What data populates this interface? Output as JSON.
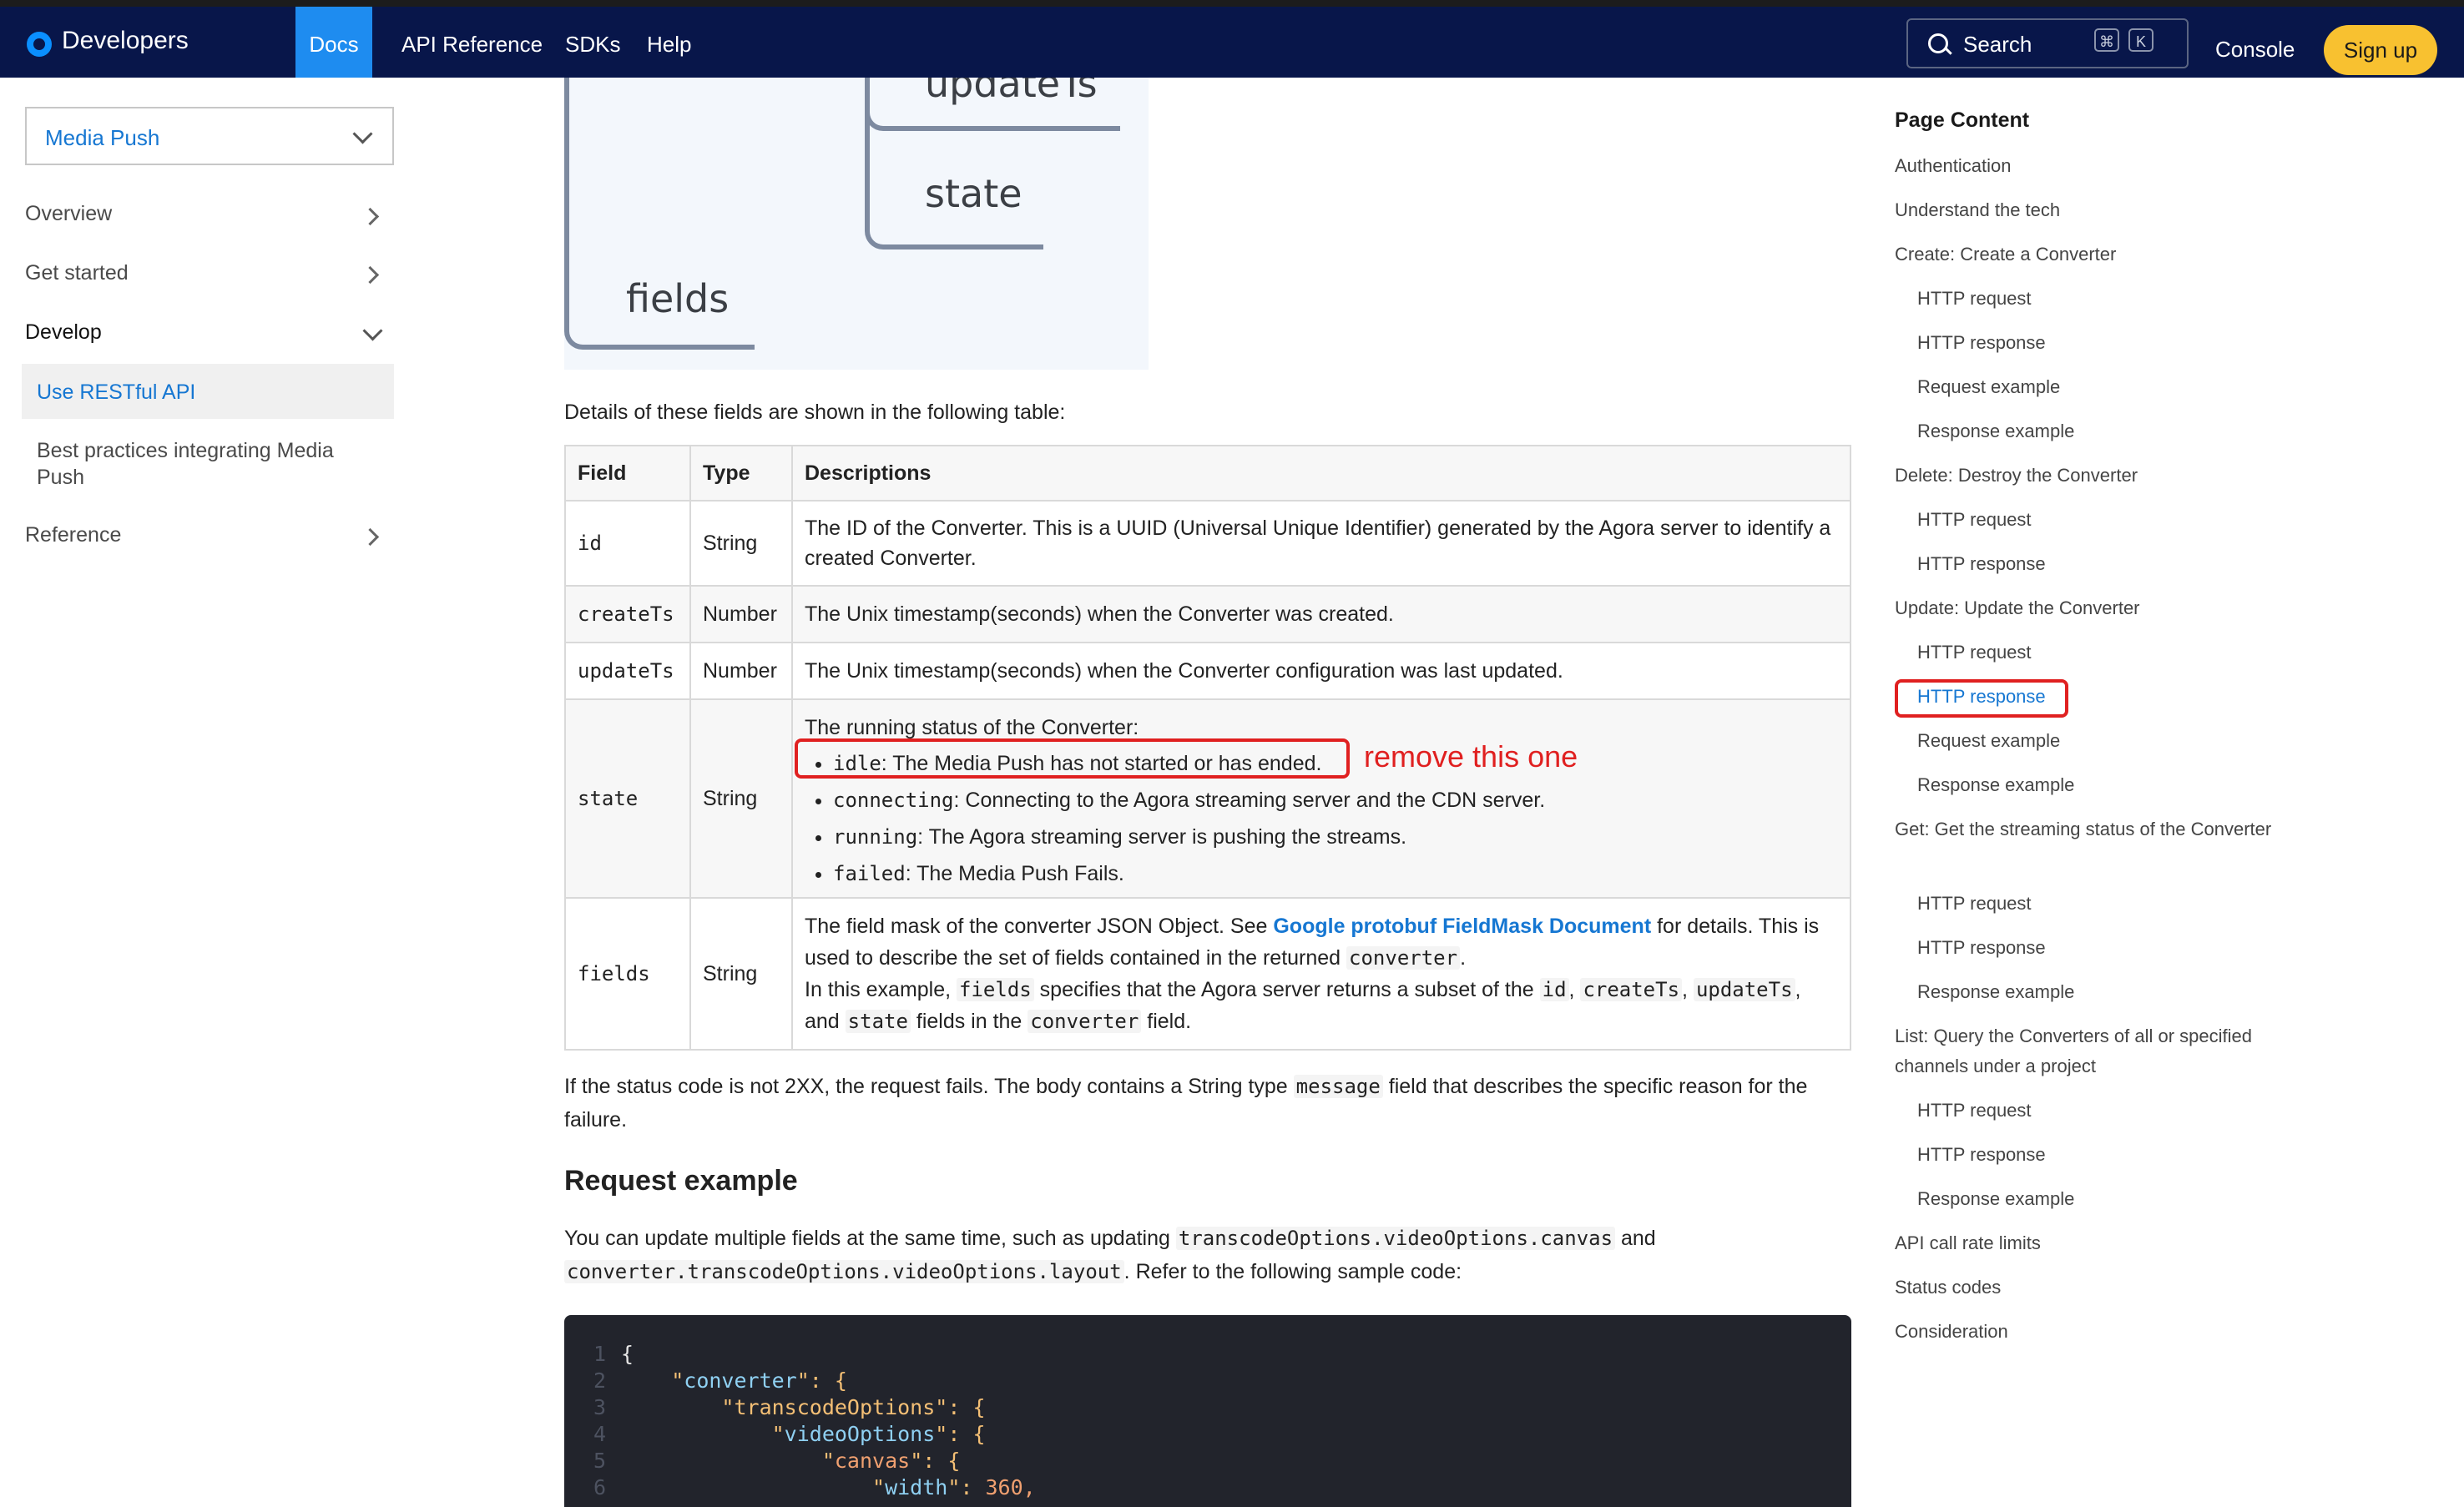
{
  "nav": {
    "brand": "Developers",
    "links": [
      "Docs",
      "API Reference",
      "SDKs",
      "Help"
    ],
    "search_label": "Search",
    "kbd_cmd": "⌘",
    "kbd_k": "K",
    "console": "Console",
    "signup": "Sign up",
    "colors": {
      "bar": "#08164a",
      "active": "#1e8cf0",
      "signup": "#f8c130"
    }
  },
  "sidebar": {
    "product": "Media Push",
    "items": [
      "Overview",
      "Get started",
      "Develop"
    ],
    "active_item": "Use RESTful API",
    "sub_item": "Best practices integrating Media Push",
    "reference": "Reference"
  },
  "diagram": {
    "labels": [
      "updateTs",
      "state",
      "fields"
    ]
  },
  "content": {
    "intro": "Details of these fields are shown in the following table:",
    "table": {
      "headers": [
        "Field",
        "Type",
        "Descriptions"
      ],
      "rows": [
        {
          "field": "id",
          "type": "String",
          "desc": "The ID of the Converter. This is a UUID (Universal Unique Identifier) generated by the Agora server to identify a created Converter."
        },
        {
          "field": "createTs",
          "type": "Number",
          "desc": "The Unix timestamp(seconds) when the Converter was created."
        },
        {
          "field": "updateTs",
          "type": "Number",
          "desc": "The Unix timestamp(seconds) when the Converter configuration was last updated."
        },
        {
          "field": "state",
          "type": "String",
          "desc_intro": "The running status of the Converter:",
          "states": [
            {
              "code": "idle",
              "text": ": The Media Push has not started or has ended."
            },
            {
              "code": "connecting",
              "text": ": Connecting to the Agora streaming server and the CDN server."
            },
            {
              "code": "running",
              "text": ": The Agora streaming server is pushing the streams."
            },
            {
              "code": "failed",
              "text": ": The Media Push Fails."
            }
          ]
        },
        {
          "field": "fields",
          "type": "String",
          "d1": "The field mask of the converter JSON Object. See ",
          "d1_link": "Google protobuf FieldMask Document",
          "d1_end": " for details. This is used to describe the set of fields contained in the returned ",
          "d1_code": "converter",
          "d1_dot": ".",
          "d2": "In this example, ",
          "d2_code1": "fields",
          "d2_mid": " specifies that the Agora server returns a subset of the ",
          "d2_code2": "id",
          "d2_comma1": ", ",
          "d2_code3": "createTs",
          "d2_comma2": ", ",
          "d2_code4": "updateTs",
          "d2_comma3": ",",
          "d2_and": " and ",
          "d2_code5": "state",
          "d2_in": " fields in the ",
          "d2_code6": "converter",
          "d2_end": " field."
        }
      ]
    },
    "failure_a": "If the status code is not 2XX, the request fails. The body contains a String type ",
    "failure_code": "message",
    "failure_b": " field that describes the specific reason for the failure.",
    "heading": "Request example",
    "req_a": "You can update multiple fields at the same time, such as updating ",
    "req_code1": "transcodeOptions.videoOptions.canvas",
    "req_and": " and ",
    "req_code2": "converter.transcodeOptions.videoOptions.layout",
    "req_b": ". Refer to the following sample code:"
  },
  "annotation": {
    "note": "remove this one",
    "color": "#e02020"
  },
  "code": {
    "lines": [
      {
        "n": "1",
        "p0": "{",
        "k": "",
        "p1": "",
        "v": ""
      },
      {
        "n": "2",
        "p0": "    \"",
        "k": "converter",
        "p1": "\": {",
        "v": ""
      },
      {
        "n": "3",
        "p0": "        \"",
        "k": "transcodeOptions",
        "p1": "\": {",
        "v": ""
      },
      {
        "n": "4",
        "p0": "            \"",
        "k": "videoOptions",
        "p1": "\": {",
        "v": ""
      },
      {
        "n": "5",
        "p0": "                \"",
        "k": "canvas",
        "p1": "\": {",
        "v": ""
      },
      {
        "n": "6",
        "p0": "                    \"",
        "k": "width",
        "p1": "\": ",
        "v": "360,"
      }
    ]
  },
  "toc": {
    "title": "Page Content",
    "items": [
      {
        "label": "Authentication",
        "level": 1
      },
      {
        "label": "Understand the tech",
        "level": 1
      },
      {
        "label": "Create: Create a Converter",
        "level": 1
      },
      {
        "label": "HTTP request",
        "level": 2
      },
      {
        "label": "HTTP response",
        "level": 2
      },
      {
        "label": "Request example",
        "level": 2
      },
      {
        "label": "Response example",
        "level": 2
      },
      {
        "label": "Delete: Destroy the Converter",
        "level": 1
      },
      {
        "label": "HTTP request",
        "level": 2
      },
      {
        "label": "HTTP response",
        "level": 2
      },
      {
        "label": "Update: Update the Converter",
        "level": 1
      },
      {
        "label": "HTTP request",
        "level": 2
      },
      {
        "label": "HTTP response",
        "level": 2,
        "active": true
      },
      {
        "label": "Request example",
        "level": 2
      },
      {
        "label": "Response example",
        "level": 2
      },
      {
        "label": "Get: Get the streaming status of the Converter",
        "level": 1
      },
      {
        "label": "HTTP request",
        "level": 2
      },
      {
        "label": "HTTP response",
        "level": 2
      },
      {
        "label": "Response example",
        "level": 2
      },
      {
        "label": "List: Query the Converters of all or specified channels under a project",
        "level": 1
      },
      {
        "label": "HTTP request",
        "level": 2
      },
      {
        "label": "HTTP response",
        "level": 2
      },
      {
        "label": "Response example",
        "level": 2
      },
      {
        "label": "API call rate limits",
        "level": 1
      },
      {
        "label": "Status codes",
        "level": 1
      },
      {
        "label": "Consideration",
        "level": 1
      }
    ]
  }
}
